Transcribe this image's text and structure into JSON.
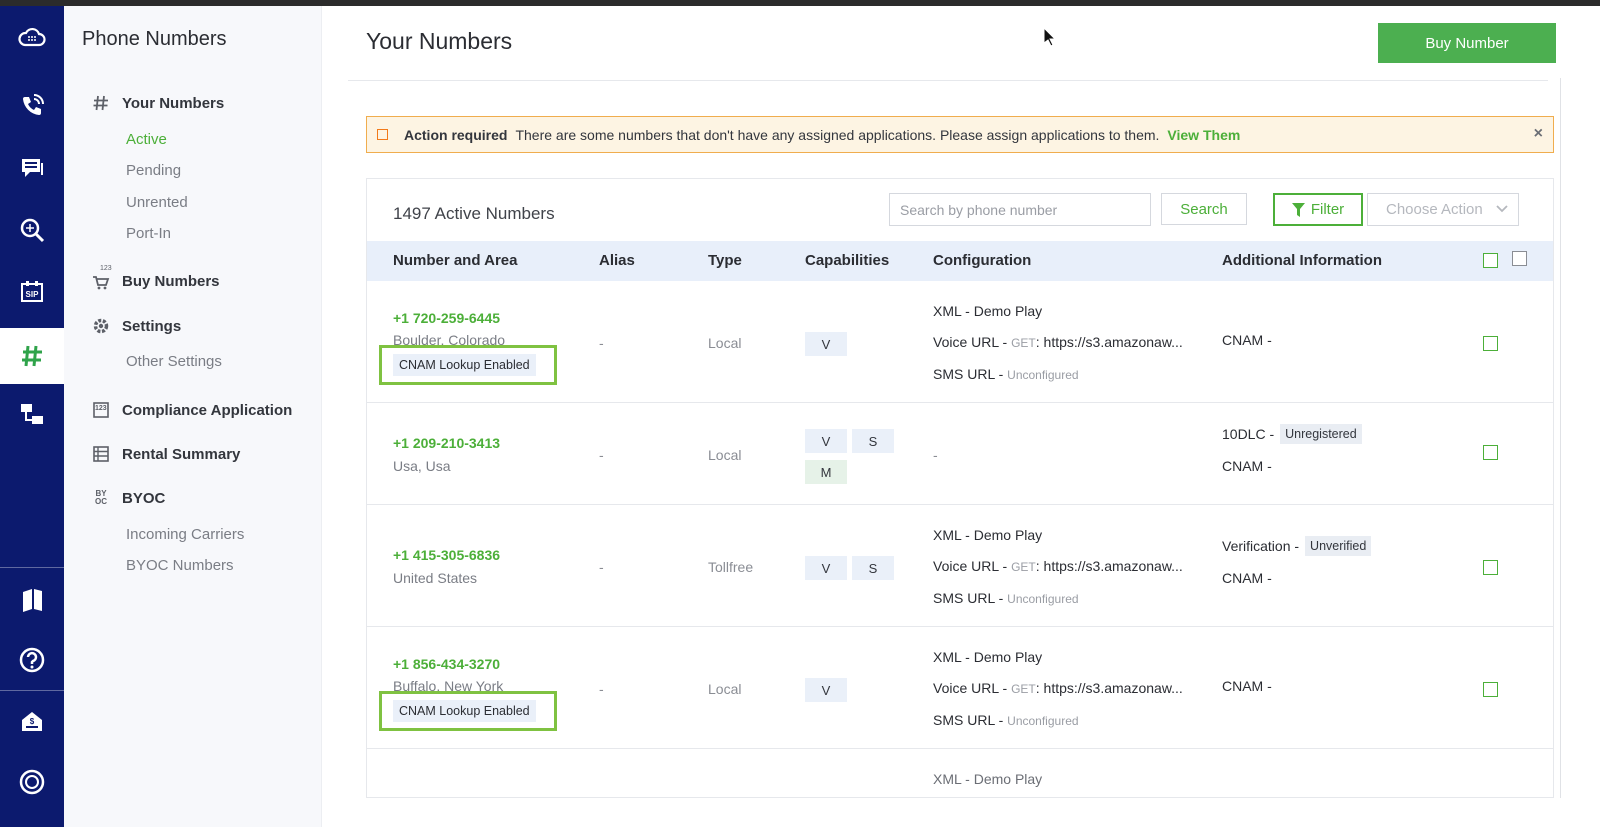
{
  "nav": {
    "title": "Phone Numbers",
    "groups": [
      {
        "label": "Your Numbers",
        "items": [
          "Active",
          "Pending",
          "Unrented",
          "Port-In"
        ]
      },
      {
        "label": "Buy Numbers"
      },
      {
        "label": "Settings",
        "items": [
          "Other Settings"
        ]
      },
      {
        "label": "Compliance Application"
      },
      {
        "label": "Rental Summary"
      },
      {
        "label": "BYOC",
        "items": [
          "Incoming Carriers",
          "BYOC Numbers"
        ]
      }
    ],
    "icon_badges": {
      "buy": "123",
      "compliance": "123",
      "byoc": "BY OC"
    }
  },
  "header": {
    "title": "Your Numbers",
    "buy_button": "Buy Number"
  },
  "alert": {
    "strong": "Action required",
    "text": "There are some numbers that don't have any assigned applications. Please assign applications to them.",
    "link": "View Them",
    "close": "×"
  },
  "toolbar": {
    "count": "1497 Active Numbers",
    "search_placeholder": "Search by phone number",
    "search_button": "Search",
    "filter_button": "Filter",
    "action_select": "Choose Action"
  },
  "columns": [
    "Number and Area",
    "Alias",
    "Type",
    "Capabilities",
    "Configuration",
    "Additional Information"
  ],
  "rows": [
    {
      "number": "+1 720-259-6445",
      "area": "Boulder, Colorado",
      "cnam_tag": "CNAM Lookup Enabled",
      "alias": "-",
      "type": "Local",
      "caps": [
        "V"
      ],
      "config": {
        "app": "XML - Demo Play",
        "voice_label": "Voice URL - ",
        "method": "GET",
        "voice_url": ": https://s3.amazonaw...",
        "sms_label": "SMS URL - ",
        "sms_value": "Unconfigured"
      },
      "info": [
        {
          "label": "CNAM -"
        }
      ]
    },
    {
      "number": "+1 209-210-3413",
      "area": "Usa, Usa",
      "alias": "-",
      "type": "Local",
      "caps": [
        "V",
        "S",
        "M"
      ],
      "config_empty": "-",
      "info": [
        {
          "label": "10DLC -",
          "pill": "Unregistered"
        },
        {
          "label": "CNAM -"
        }
      ]
    },
    {
      "number": "+1 415-305-6836",
      "area": "United States",
      "alias": "-",
      "type": "Tollfree",
      "caps": [
        "V",
        "S"
      ],
      "config": {
        "app": "XML - Demo Play",
        "voice_label": "Voice URL - ",
        "method": "GET",
        "voice_url": ": https://s3.amazonaw...",
        "sms_label": "SMS URL - ",
        "sms_value": "Unconfigured"
      },
      "info": [
        {
          "label": "Verification -",
          "pill": "Unverified"
        },
        {
          "label": "CNAM -"
        }
      ]
    },
    {
      "number": "+1 856-434-3270",
      "area": "Buffalo, New York",
      "cnam_tag": "CNAM Lookup Enabled",
      "alias": "-",
      "type": "Local",
      "caps": [
        "V"
      ],
      "config": {
        "app": "XML - Demo Play",
        "voice_label": "Voice URL - ",
        "method": "GET",
        "voice_url": ": https://s3.amazonaw...",
        "sms_label": "SMS URL - ",
        "sms_value": "Unconfigured"
      },
      "info": [
        {
          "label": "CNAM -"
        }
      ]
    },
    {
      "config": {
        "app": "XML - Demo Play"
      }
    }
  ],
  "colors": {
    "rail": "#0c1a6e",
    "accent": "#4caf39",
    "button": "#4caf50",
    "alert_border": "#f0ad4e",
    "highlight": "#7fc241"
  }
}
